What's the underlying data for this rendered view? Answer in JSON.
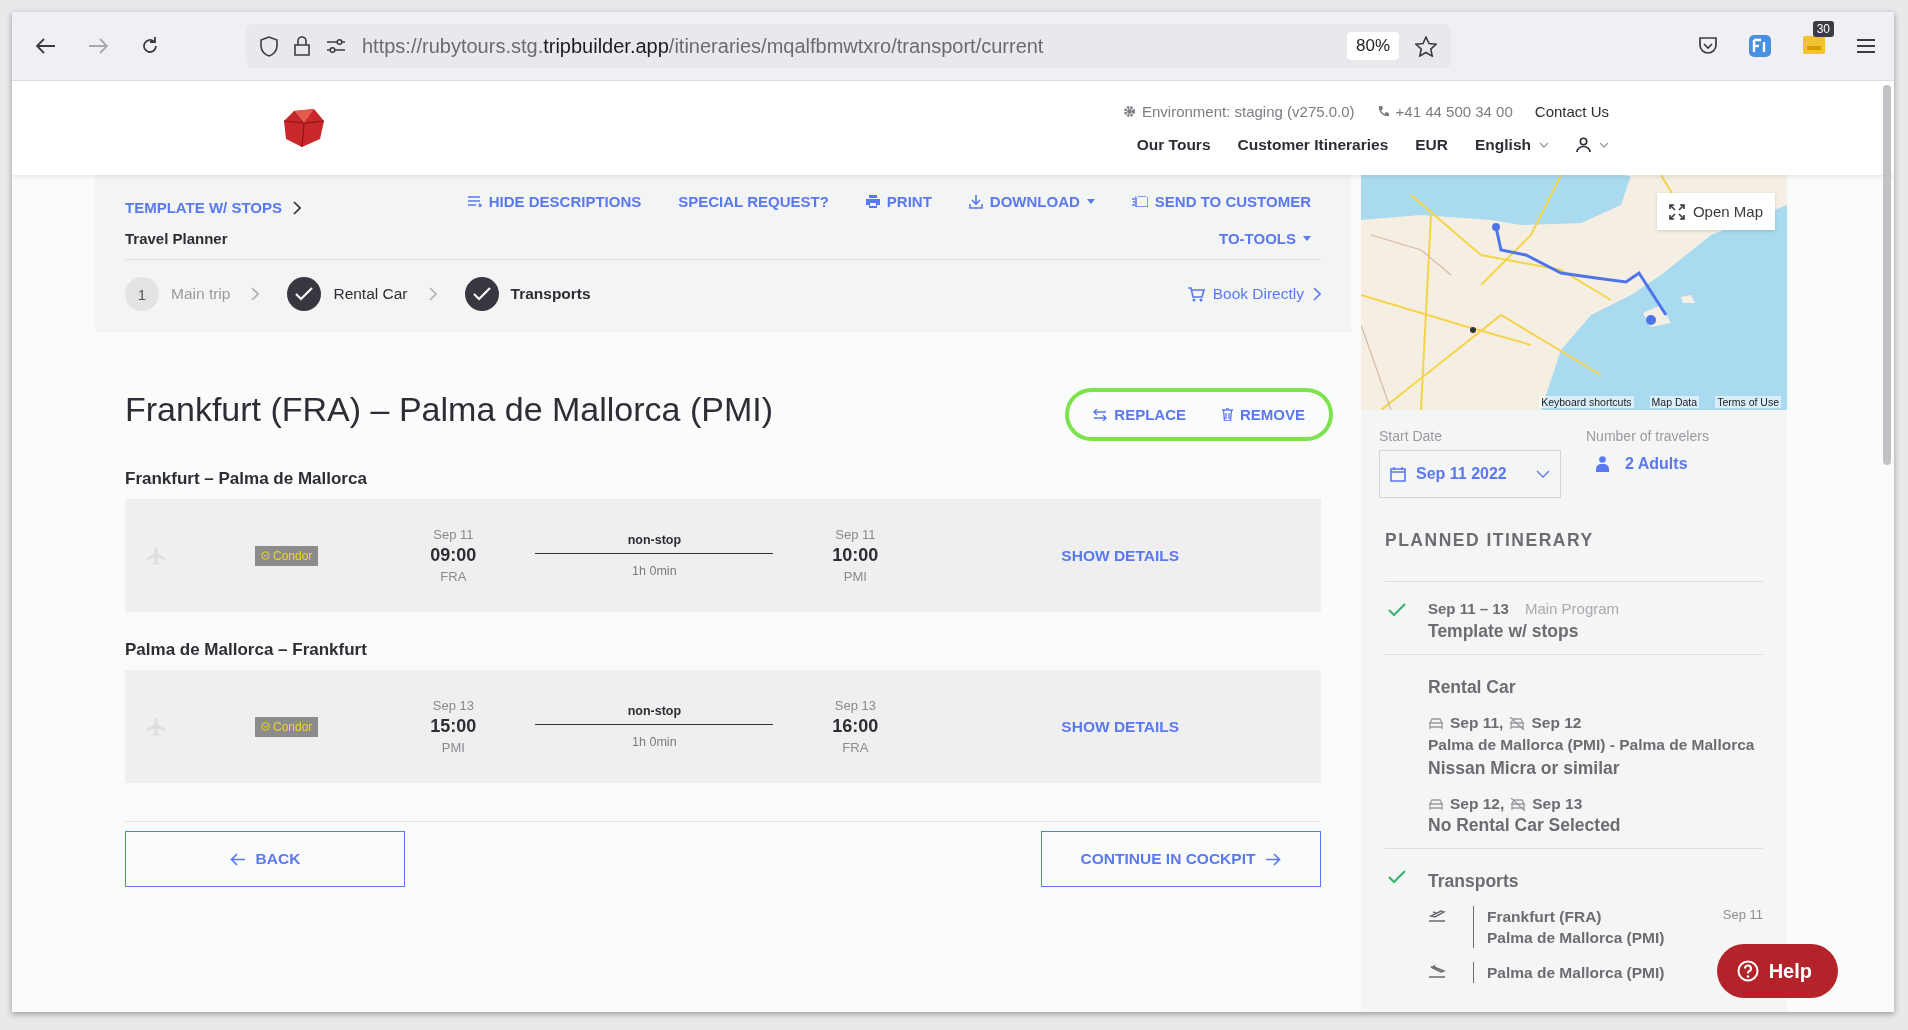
{
  "browser": {
    "url": "https://rubytours.stg.**tripbuilder.app**/itineraries/mqalfbmwtxro/transport/current",
    "zoom": "80%",
    "extension_badge": "30"
  },
  "header": {
    "environment": "Environment: staging (v275.0.0)",
    "phone": "+41 44 500 34 00",
    "contact": "Contact Us",
    "nav": [
      "Our Tours",
      "Customer Itineraries",
      "EUR",
      "English"
    ]
  },
  "toolbar": {
    "breadcrumb": "TEMPLATE W/ STOPS",
    "subtitle": "Travel Planner",
    "actions": [
      {
        "kind": "lines",
        "label": "HIDE DESCRIPTIONS",
        "dropdown": false
      },
      {
        "kind": "none",
        "label": "SPECIAL REQUEST?",
        "dropdown": false
      },
      {
        "kind": "printer",
        "label": "PRINT",
        "dropdown": false
      },
      {
        "kind": "download",
        "label": "DOWNLOAD",
        "dropdown": true
      },
      {
        "kind": "send",
        "label": "SEND TO CUSTOMER",
        "dropdown": false
      }
    ],
    "tools": "TO-TOOLS"
  },
  "steps": [
    {
      "number": "1",
      "label": "Main trip",
      "done": false,
      "selected": false
    },
    {
      "label": "Rental Car",
      "done": true,
      "selected": false
    },
    {
      "label": "Transports",
      "done": true,
      "selected": true
    }
  ],
  "book_directly": "Book Directly",
  "transport": {
    "title": "Frankfurt (FRA) – Palma de Mallorca (PMI)",
    "highlighted": true,
    "actions": [
      {
        "kind": "swap",
        "label": "REPLACE"
      },
      {
        "kind": "trash",
        "label": "REMOVE"
      }
    ]
  },
  "segments": [
    {
      "title": "Frankfurt – Palma de Mallorca",
      "carrier": "Condor",
      "departure": {
        "date": "Sep 11",
        "time": "09:00",
        "airport": "FRA"
      },
      "stops": "non-stop",
      "duration": "1h 0min",
      "arrival": {
        "date": "Sep 11",
        "time": "10:00",
        "airport": "PMI"
      },
      "details": "SHOW DETAILS"
    },
    {
      "title": "Palma de Mallorca – Frankfurt",
      "carrier": "Condor",
      "departure": {
        "date": "Sep 13",
        "time": "15:00",
        "airport": "PMI"
      },
      "stops": "non-stop",
      "duration": "1h 0min",
      "arrival": {
        "date": "Sep 13",
        "time": "16:00",
        "airport": "FRA"
      },
      "details": "SHOW DETAILS"
    }
  ],
  "buttons": {
    "back": "BACK",
    "continue": "CONTINUE IN COCKPIT"
  },
  "sidebar": {
    "map": {
      "kind": "picture",
      "open_map": "Open Map",
      "links": [
        "Keyboard shortcuts",
        "Map Data",
        "Terms of Use"
      ]
    },
    "start_date": {
      "label": "Start Date",
      "value": "Sep 11 2022"
    },
    "travelers": {
      "label": "Number of travelers",
      "value": "2 Adults"
    },
    "heading": "PLANNED ITINERARY",
    "sections": [
      {
        "kind": "program",
        "checked": true,
        "dates": "Sep 11 – 13",
        "type": "Main Program",
        "title": "Template w/ stops"
      },
      {
        "kind": "rental",
        "checked": false,
        "title": "Rental Car",
        "rentals": [
          {
            "pickup": "Sep 11,",
            "dropoff": "Sep 12",
            "route": "Palma de Mallorca (PMI) - Palma de Mallorca",
            "car": "Nissan Micra or similar"
          },
          {
            "pickup": "Sep 12,",
            "dropoff": "Sep 13",
            "car": "No Rental Car Selected"
          }
        ]
      },
      {
        "kind": "transports",
        "checked": true,
        "title": "Transports",
        "flights": [
          {
            "kind": "departure",
            "from": "Frankfurt (FRA)",
            "to": "Palma de Mallorca (PMI)",
            "date": "Sep 11"
          },
          {
            "kind": "arrival",
            "from": "Palma de Mallorca (PMI)"
          }
        ]
      }
    ]
  },
  "help": "Help"
}
